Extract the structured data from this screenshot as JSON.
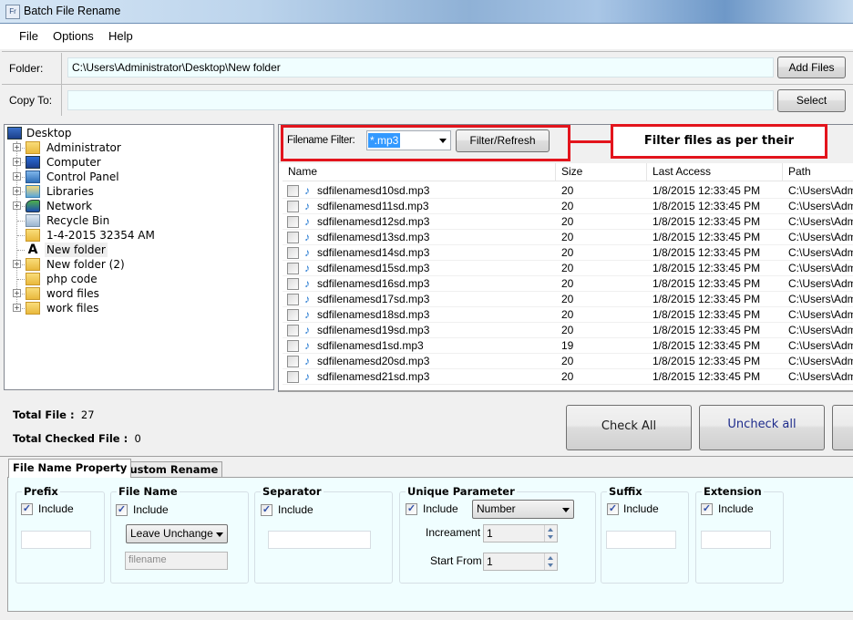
{
  "window": {
    "title": "Batch File Rename",
    "icon": "app-icon"
  },
  "menu": [
    {
      "label": "File"
    },
    {
      "label": "Options"
    },
    {
      "label": "Help"
    }
  ],
  "paths": {
    "folder_label": "Folder:",
    "folder_value": "C:\\Users\\Administrator\\Desktop\\New folder",
    "add_files_label": "Add Files",
    "copy_to_label": "Copy To:",
    "copy_to_value": "",
    "select_label": "Select"
  },
  "tree": {
    "root": {
      "label": "Desktop",
      "icon": "desktop-icon"
    },
    "items": [
      {
        "label": "Administrator",
        "icon": "user-folder-icon",
        "expandable": true
      },
      {
        "label": "Computer",
        "icon": "computer-icon",
        "expandable": true
      },
      {
        "label": "Control Panel",
        "icon": "control-panel-icon",
        "expandable": true
      },
      {
        "label": "Libraries",
        "icon": "libraries-icon",
        "expandable": true
      },
      {
        "label": "Network",
        "icon": "network-icon",
        "expandable": true
      },
      {
        "label": "Recycle Bin",
        "icon": "recycle-bin-icon",
        "expandable": false
      },
      {
        "label": "1-4-2015 32354 AM",
        "icon": "folder-icon",
        "expandable": false
      },
      {
        "label": "New folder",
        "icon": "font-folder-icon",
        "expandable": false,
        "selected": true
      },
      {
        "label": "New folder (2)",
        "icon": "folder-icon",
        "expandable": true
      },
      {
        "label": "php code",
        "icon": "folder-icon",
        "expandable": false
      },
      {
        "label": "word files",
        "icon": "folder-icon",
        "expandable": true
      },
      {
        "label": "work files",
        "icon": "folder-icon",
        "expandable": true
      }
    ]
  },
  "filter": {
    "label": "Filename Filter:",
    "value": "*.mp3",
    "button_label": "Filter/Refresh",
    "callout": "Filter files as per their extension",
    "accent_color": "#e3141c"
  },
  "file_list": {
    "columns": [
      "Name",
      "Size",
      "Last Access",
      "Path"
    ],
    "rows": [
      {
        "name": "sdfilenamesd10sd.mp3",
        "size": "20",
        "last_access": "1/8/2015 12:33:45 PM",
        "path": "C:\\Users\\Admi",
        "checked": false
      },
      {
        "name": "sdfilenamesd11sd.mp3",
        "size": "20",
        "last_access": "1/8/2015 12:33:45 PM",
        "path": "C:\\Users\\Admi",
        "checked": false
      },
      {
        "name": "sdfilenamesd12sd.mp3",
        "size": "20",
        "last_access": "1/8/2015 12:33:45 PM",
        "path": "C:\\Users\\Admi",
        "checked": false
      },
      {
        "name": "sdfilenamesd13sd.mp3",
        "size": "20",
        "last_access": "1/8/2015 12:33:45 PM",
        "path": "C:\\Users\\Admi",
        "checked": false
      },
      {
        "name": "sdfilenamesd14sd.mp3",
        "size": "20",
        "last_access": "1/8/2015 12:33:45 PM",
        "path": "C:\\Users\\Admi",
        "checked": false
      },
      {
        "name": "sdfilenamesd15sd.mp3",
        "size": "20",
        "last_access": "1/8/2015 12:33:45 PM",
        "path": "C:\\Users\\Admi",
        "checked": false
      },
      {
        "name": "sdfilenamesd16sd.mp3",
        "size": "20",
        "last_access": "1/8/2015 12:33:45 PM",
        "path": "C:\\Users\\Admi",
        "checked": false
      },
      {
        "name": "sdfilenamesd17sd.mp3",
        "size": "20",
        "last_access": "1/8/2015 12:33:45 PM",
        "path": "C:\\Users\\Admi",
        "checked": false
      },
      {
        "name": "sdfilenamesd18sd.mp3",
        "size": "20",
        "last_access": "1/8/2015 12:33:45 PM",
        "path": "C:\\Users\\Admi",
        "checked": false
      },
      {
        "name": "sdfilenamesd19sd.mp3",
        "size": "20",
        "last_access": "1/8/2015 12:33:45 PM",
        "path": "C:\\Users\\Admi",
        "checked": false
      },
      {
        "name": "sdfilenamesd1sd.mp3",
        "size": "19",
        "last_access": "1/8/2015 12:33:45 PM",
        "path": "C:\\Users\\Admi",
        "checked": false
      },
      {
        "name": "sdfilenamesd20sd.mp3",
        "size": "20",
        "last_access": "1/8/2015 12:33:45 PM",
        "path": "C:\\Users\\Admi",
        "checked": false
      },
      {
        "name": "sdfilenamesd21sd.mp3",
        "size": "20",
        "last_access": "1/8/2015 12:33:45 PM",
        "path": "C:\\Users\\Admi",
        "checked": false
      }
    ]
  },
  "totals": {
    "total_file_label": "Total File :",
    "total_file_value": "27",
    "total_checked_label": "Total Checked File :",
    "total_checked_value": "0"
  },
  "actions": {
    "check_all": "Check All",
    "uncheck_all": "Uncheck all"
  },
  "tabs": [
    {
      "label": "File Name Property",
      "active": true
    },
    {
      "label": "Custom Rename",
      "active": false
    }
  ],
  "rename": {
    "include_label": "Include",
    "prefix": {
      "title": "Prefix",
      "include": true,
      "value": ""
    },
    "file_name": {
      "title": "File Name",
      "include": true,
      "mode": "Leave Unchange",
      "placeholder": "filename"
    },
    "separator": {
      "title": "Separator",
      "include": true,
      "value": ""
    },
    "unique": {
      "title": "Unique Parameter",
      "include": true,
      "type": "Number",
      "increment_label": "Increament",
      "increment": "1",
      "start_label": "Start From",
      "start": "1"
    },
    "suffix": {
      "title": "Suffix",
      "include": true,
      "value": ""
    },
    "extension": {
      "title": "Extension",
      "include": true,
      "value": ""
    }
  }
}
